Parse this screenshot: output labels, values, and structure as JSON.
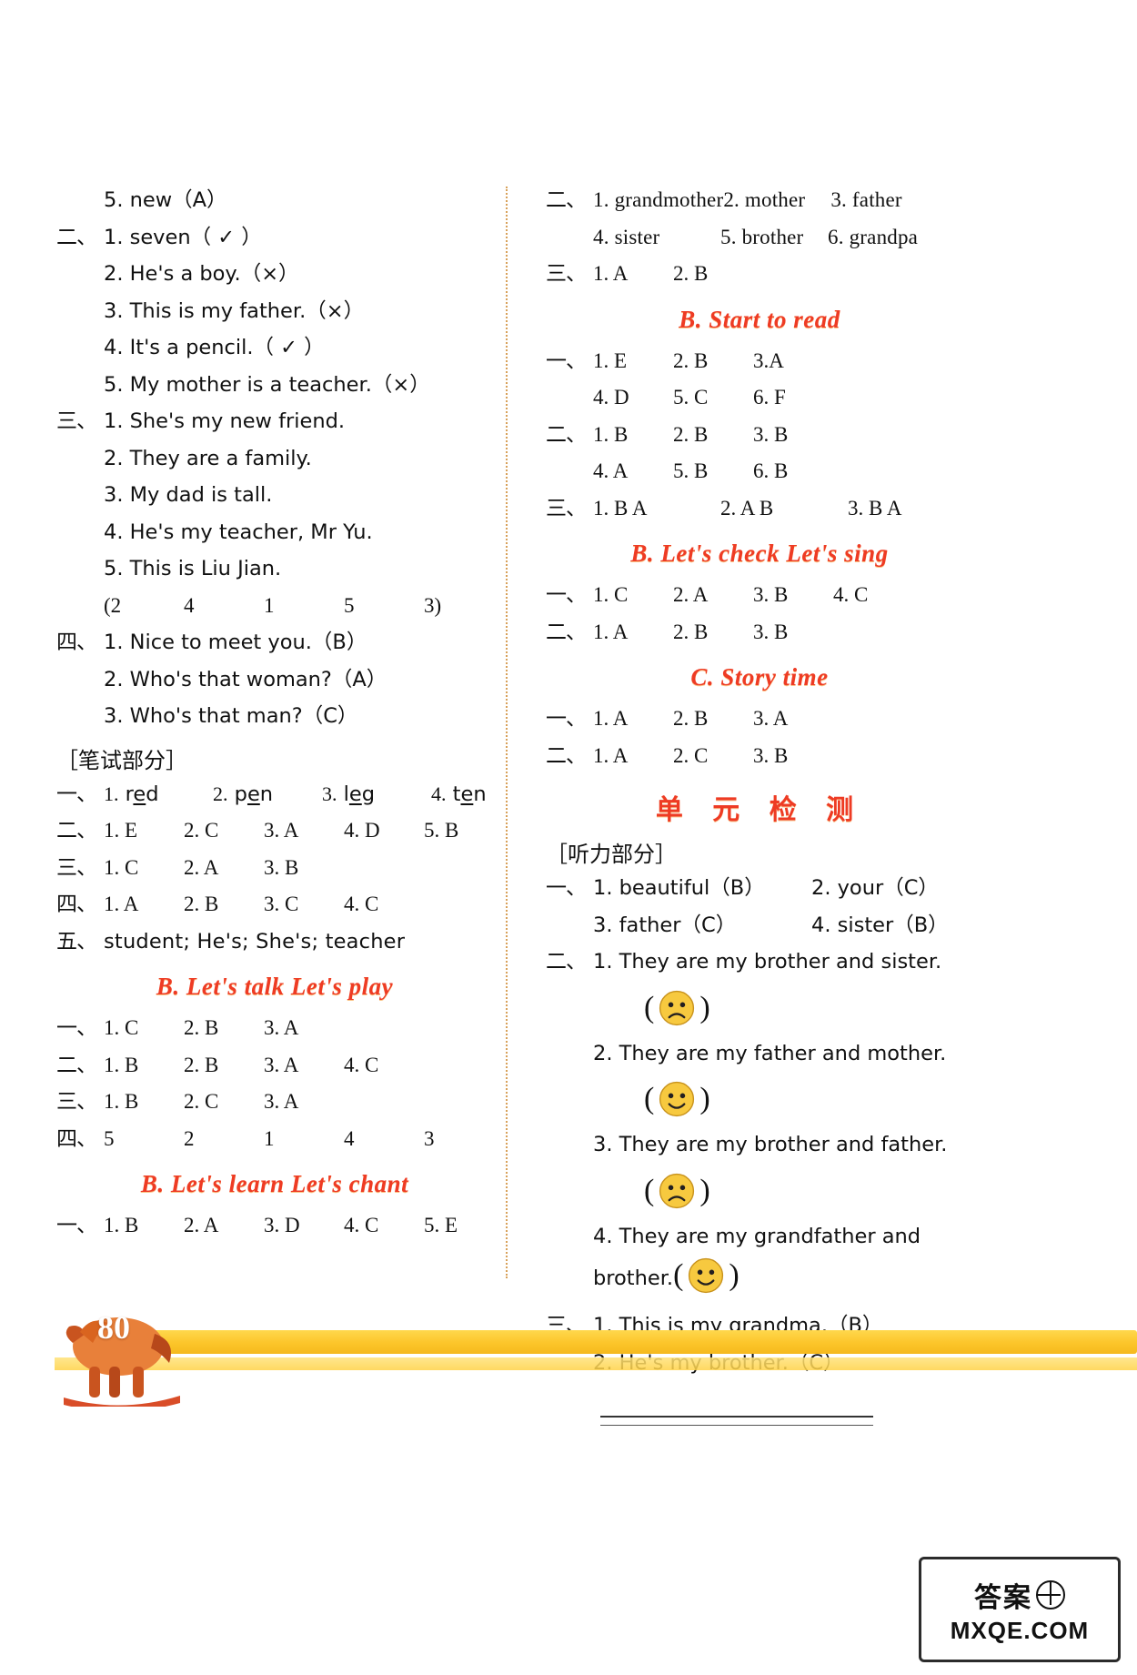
{
  "page": {
    "number": "80",
    "watermark_top": "答案",
    "watermark_bottom": "MXQE.COM"
  },
  "left_column": {
    "listening_tail": {
      "rows": [
        {
          "marker": "",
          "text": "5. new（A）"
        },
        {
          "marker": "二、",
          "text": "1. seven（ ✓ ）"
        },
        {
          "marker": "",
          "text": "2. He's a boy.（×）"
        },
        {
          "marker": "",
          "text": "3. This is my father.（×）"
        },
        {
          "marker": "",
          "text": "4. It's a pencil.（ ✓ ）"
        },
        {
          "marker": "",
          "text": "5. My mother is a teacher.（×）"
        },
        {
          "marker": "三、",
          "text": "1. She's my new friend."
        },
        {
          "marker": "",
          "text": "2. They are a family."
        },
        {
          "marker": "",
          "text": "3. My dad is tall."
        },
        {
          "marker": "",
          "text": "4. He's my teacher, Mr Yu."
        },
        {
          "marker": "",
          "text": "5. This is Liu Jian."
        }
      ],
      "order_row": {
        "open": "(2",
        "values": [
          "4",
          "1",
          "5"
        ],
        "close": "3)"
      },
      "rows4": [
        {
          "marker": "四、",
          "text": "1. Nice to meet you.（B）"
        },
        {
          "marker": "",
          "text": "2. Who's that woman?（A）"
        },
        {
          "marker": "",
          "text": "3. Who's that man?（C）"
        }
      ]
    },
    "written_header": "［笔试部分］",
    "written": {
      "row1_marker": "一、",
      "row1_words": [
        {
          "n": "1.",
          "pre": "r",
          "mid": "e",
          "post": "d"
        },
        {
          "n": "2.",
          "pre": "p",
          "mid": "e",
          "post": "n"
        },
        {
          "n": "3.",
          "pre": "l",
          "mid": "e",
          "post": "g"
        },
        {
          "n": "4.",
          "pre": "t",
          "mid": "e",
          "post": "n"
        }
      ],
      "rows": [
        {
          "marker": "二、",
          "answers": [
            "1. E",
            "2. C",
            "3. A",
            "4. D",
            "5. B"
          ]
        },
        {
          "marker": "三、",
          "answers": [
            "1. C",
            "2. A",
            "3. B"
          ]
        },
        {
          "marker": "四、",
          "answers": [
            "1. A",
            "2. B",
            "3. C",
            "4. C"
          ]
        }
      ],
      "row5_marker": "五、",
      "row5_text": "student; He's; She's; teacher"
    },
    "section_talk_play": {
      "heading": "B. Let's talk  Let's play",
      "rows": [
        {
          "marker": "一、",
          "answers": [
            "1. C",
            "2. B",
            "3. A"
          ]
        },
        {
          "marker": "二、",
          "answers": [
            "1. B",
            "2. B",
            "3. A",
            "4. C"
          ]
        },
        {
          "marker": "三、",
          "answers": [
            "1. B",
            "2. C",
            "3. A"
          ]
        },
        {
          "marker": "四、",
          "answers": [
            "5",
            "2",
            "1",
            "4",
            "3"
          ]
        }
      ]
    },
    "section_learn_chant": {
      "heading": "B. Let's learn  Let's chant",
      "rows": [
        {
          "marker": "一、",
          "answers": [
            "1. B",
            "2. A",
            "3. D",
            "4. C",
            "5. E"
          ]
        }
      ]
    }
  },
  "right_column": {
    "top_rows": [
      {
        "marker": "二、",
        "answers": [
          "1. grandmother",
          "2. mother",
          "3. father"
        ]
      },
      {
        "marker": "",
        "answers": [
          "4. sister",
          "5. brother",
          "6. grandpa"
        ]
      },
      {
        "marker": "三、",
        "answers": [
          "1. A",
          "2. B"
        ]
      }
    ],
    "section_start_to_read": {
      "heading": "B. Start to read",
      "rows": [
        {
          "marker": "一、",
          "answers": [
            "1. E",
            "2. B",
            "3.A"
          ]
        },
        {
          "marker": "",
          "answers": [
            "4. D",
            "5. C",
            "6. F"
          ]
        },
        {
          "marker": "二、",
          "answers": [
            "1. B",
            "2. B",
            "3. B"
          ]
        },
        {
          "marker": "",
          "answers": [
            "4. A",
            "5. B",
            "6. B"
          ]
        },
        {
          "marker": "三、",
          "answers": [
            "1. B  A",
            "2. A  B",
            "3. B  A"
          ]
        }
      ]
    },
    "section_check_sing": {
      "heading": "B. Let's check  Let's sing",
      "rows": [
        {
          "marker": "一、",
          "answers": [
            "1. C",
            "2. A",
            "3. B",
            "4. C"
          ]
        },
        {
          "marker": "二、",
          "answers": [
            "1. A",
            "2. B",
            "3. B"
          ]
        }
      ]
    },
    "section_story_time": {
      "heading": "C. Story time",
      "rows": [
        {
          "marker": "一、",
          "answers": [
            "1. A",
            "2. B",
            "3. A"
          ]
        },
        {
          "marker": "二、",
          "answers": [
            "1. A",
            "2. C",
            "3. B"
          ]
        }
      ]
    },
    "unit_test": {
      "heading": "单 元 检 测",
      "listening_header": "［听力部分］",
      "rows": [
        {
          "marker": "一、",
          "text": "1. beautiful（B）",
          "text2": "2. your（C）"
        },
        {
          "marker": "",
          "text": "3. father（C）",
          "text2": "4. sister（B）"
        }
      ],
      "sentences": [
        {
          "marker": "二、",
          "text": "1. They are my brother and sister.",
          "face": "sad"
        },
        {
          "marker": "",
          "text": "2. They are my father and mother.",
          "face": "happy"
        },
        {
          "marker": "",
          "text": "3. They are my brother and father.",
          "face": "sad"
        },
        {
          "marker": "",
          "text": "4. They are my grandfather and",
          "cont": "brother.",
          "face": "happy"
        }
      ],
      "rows3": [
        {
          "marker": "三、",
          "text": "1. This is my grandma.（B）"
        },
        {
          "marker": "",
          "text": "2. He's my brother.（C）"
        }
      ]
    }
  },
  "colors": {
    "heading_red": "#ee3b24",
    "banner_yellow": "#fcc52a",
    "divider": "#d8a15a",
    "face_yellow": "#f7c93f"
  }
}
